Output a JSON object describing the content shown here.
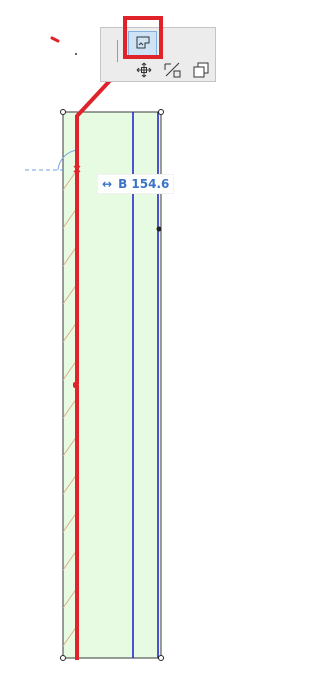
{
  "colors": {
    "wall_fill": "#e6fbe2",
    "hatch": "#e2ad86",
    "reference_line": "#1a1ac8",
    "highlight": "#e0222a",
    "dimension_text": "#3b74c7",
    "toolbar_bg": "#ececec",
    "active_tool": "#cfe3f6"
  },
  "toolbar": {
    "tools": [
      {
        "name": "offset-edge",
        "icon": "offset-edge-icon",
        "active": true
      },
      {
        "name": "move",
        "icon": "move-icon",
        "active": false
      },
      {
        "name": "adjust",
        "icon": "adjust-icon",
        "active": false
      },
      {
        "name": "copy-offset",
        "icon": "copy-offset-icon",
        "active": false
      }
    ]
  },
  "dimension": {
    "arrow": "↔",
    "label": "B",
    "value": "154.6"
  }
}
